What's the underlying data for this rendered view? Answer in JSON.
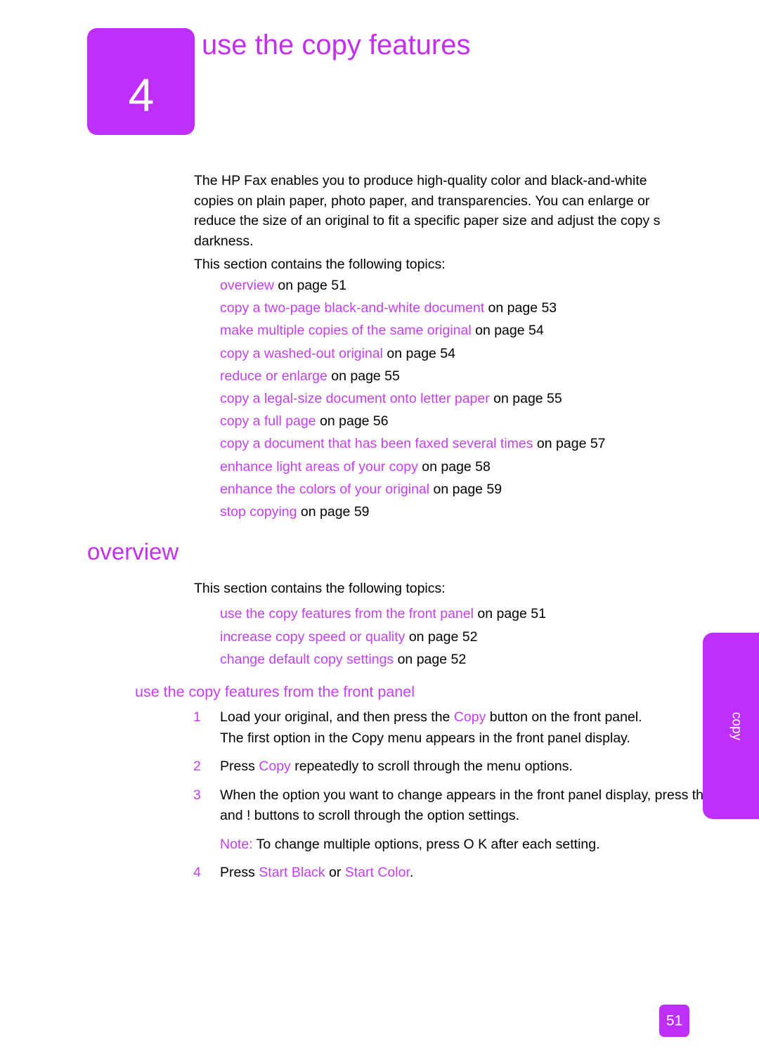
{
  "colors": {
    "brand_purple": "#c02efb",
    "heading_purple": "#c130ee",
    "link_purple": "#c43ff0",
    "body_black": "#000000",
    "page_background": "#ffffff"
  },
  "chapter": {
    "number": "4",
    "title": "use the copy features"
  },
  "intro": {
    "paragraph_1": "The HP Fax enables you to produce high-quality color and black-and-white copies on plain paper, photo paper, and transparencies. You can enlarge or reduce the size of an original to fit a specific paper size and adjust the copy s darkness.",
    "paragraph_2": "This section contains the following topics:"
  },
  "toc": [
    {
      "link": "overview",
      "suffix": " on page 51"
    },
    {
      "link": "copy a two-page black-and-white document",
      "suffix": " on page 53"
    },
    {
      "link": "make multiple copies of the same original",
      "suffix": " on page 54"
    },
    {
      "link": "copy a washed-out original",
      "suffix": " on page 54"
    },
    {
      "link": "reduce or enlarge",
      "suffix": " on page 55"
    },
    {
      "link": "copy a legal-size document onto letter paper",
      "suffix": " on page 55"
    },
    {
      "link": "copy a full page",
      "suffix": " on page 56"
    },
    {
      "link": "copy a document that has been faxed several times",
      "suffix": " on page 57"
    },
    {
      "link": "enhance light areas of your copy",
      "suffix": " on page 58"
    },
    {
      "link": "enhance the colors of your original",
      "suffix": " on page 59"
    },
    {
      "link": "stop copying",
      "suffix": " on page 59"
    }
  ],
  "overview_section": {
    "heading": "overview",
    "lead": "This section contains the following topics:",
    "toc": [
      {
        "link": "use the copy features from the front panel",
        "suffix": " on page 51"
      },
      {
        "link": "increase copy speed or quality",
        "suffix": " on page 52"
      },
      {
        "link": "change default copy settings",
        "suffix": " on page 52"
      }
    ]
  },
  "front_panel_section": {
    "subheading": "use the copy features from the front panel",
    "steps": [
      {
        "number": "1",
        "text_before": "Load your original, and then press the ",
        "emphasis": "Copy",
        "text_after": " button on the front panel.",
        "continuation": "The first option in the Copy menu appears in the front panel display."
      },
      {
        "number": "2",
        "text_before": "Press ",
        "emphasis": "Copy",
        "text_after": " repeatedly to scroll through the menu options.",
        "continuation": ""
      },
      {
        "number": "3",
        "text_before": "When the option you want to change appears in the front panel display, press the \"   and !   buttons to scroll through the option settings.",
        "emphasis": "",
        "text_after": "",
        "continuation": ""
      },
      {
        "number": "4",
        "text_before": "Press ",
        "emphasis": "Start Black",
        "text_mid": " or ",
        "emphasis_2": "Start Color",
        "text_after": ".",
        "continuation": ""
      }
    ],
    "note": {
      "label": "Note:",
      "text": " To change multiple options, press O K after each setting."
    }
  },
  "side_tab": {
    "label": "copy"
  },
  "footer": {
    "page_number": "51"
  }
}
